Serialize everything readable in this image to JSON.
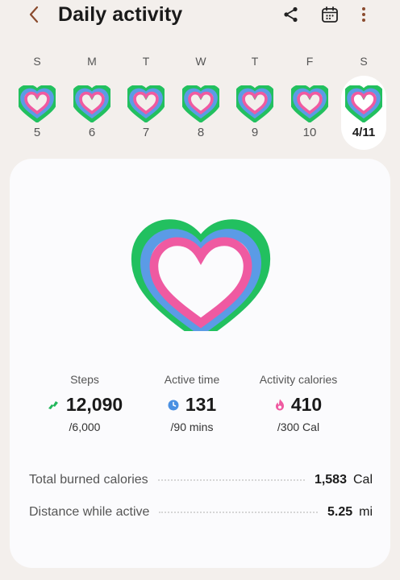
{
  "header": {
    "title": "Daily activity",
    "back_icon": "chevron-left-icon",
    "share_icon": "share-icon",
    "calendar_icon": "calendar-icon",
    "more_icon": "more-vertical-icon"
  },
  "week": [
    {
      "dow": "S",
      "date": "5"
    },
    {
      "dow": "M",
      "date": "6"
    },
    {
      "dow": "T",
      "date": "7"
    },
    {
      "dow": "W",
      "date": "8"
    },
    {
      "dow": "T",
      "date": "9"
    },
    {
      "dow": "F",
      "date": "10"
    },
    {
      "dow": "S",
      "date": "4/11",
      "selected": true
    }
  ],
  "stats": {
    "steps": {
      "label": "Steps",
      "value": "12,090",
      "goal": "/6,000",
      "icon": "shoe-icon",
      "color": "#22b75b"
    },
    "active_time": {
      "label": "Active time",
      "value": "131",
      "goal": "/90 mins",
      "icon": "clock-icon",
      "color": "#4a90e2"
    },
    "calories": {
      "label": "Activity calories",
      "value": "410",
      "goal": "/300 Cal",
      "icon": "flame-icon",
      "color": "#ef5aa1"
    }
  },
  "details": {
    "burned": {
      "label": "Total burned calories",
      "value": "1,583",
      "unit": "Cal"
    },
    "distance": {
      "label": "Distance while active",
      "value": "5.25",
      "unit": "mi"
    }
  },
  "colors": {
    "steps_ring": "#22c05f",
    "active_ring": "#5b9be6",
    "calories_ring": "#ef5aa1",
    "background": "#f3efec",
    "card": "#fbfbfd"
  }
}
